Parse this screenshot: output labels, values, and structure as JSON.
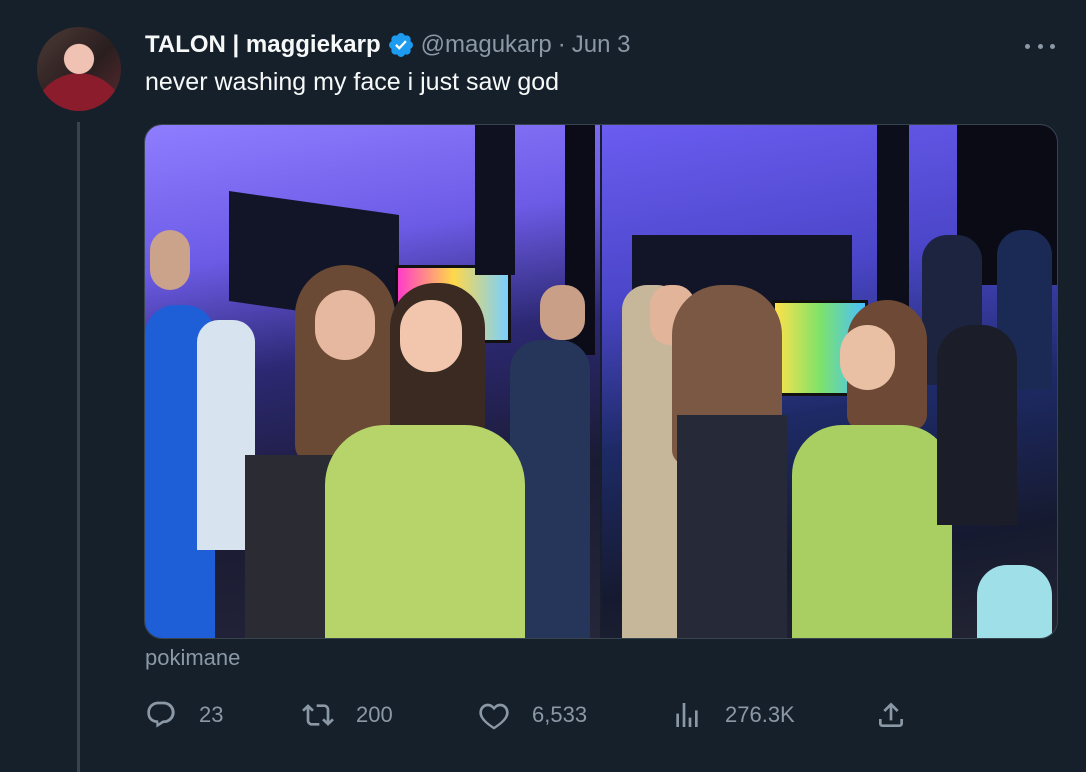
{
  "author": {
    "display_name": "TALON | maggiekarp",
    "handle": "@magukarp",
    "separator": "·",
    "date": "Jun 3",
    "verified": true
  },
  "tweet": {
    "text": "never washing my face i just saw god",
    "caption": "pokimane"
  },
  "media": {
    "images": [
      {
        "icon": "photo-two-people-hugging"
      },
      {
        "icon": "photo-two-people-face-touch"
      }
    ]
  },
  "actions": {
    "reply": {
      "icon": "reply-icon",
      "count": "23"
    },
    "retweet": {
      "icon": "retweet-icon",
      "count": "200"
    },
    "like": {
      "icon": "heart-icon",
      "count": "6,533"
    },
    "views": {
      "icon": "views-chart-icon",
      "count": "276.3K"
    },
    "share": {
      "icon": "share-icon"
    }
  },
  "colors": {
    "background": "#15202b",
    "text_primary": "#f7f9f9",
    "text_secondary": "#8b98a5",
    "verified_blue": "#1d9bf0",
    "border": "#38444d"
  }
}
